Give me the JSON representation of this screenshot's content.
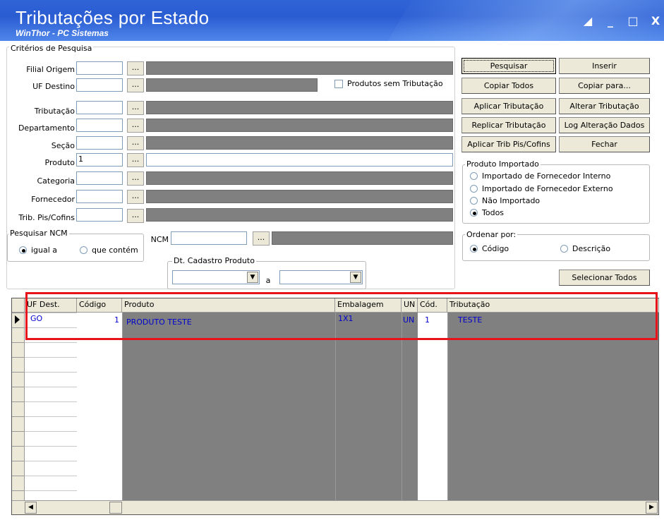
{
  "window": {
    "title": "Tributações por Estado",
    "subtitle": "WinThor - PC Sistemas",
    "controls": [
      "◢",
      "_",
      "□",
      "X"
    ]
  },
  "criteria": {
    "group_label": "Critérios de Pesquisa",
    "fields": {
      "filial_origem": "Filial Origem",
      "uf_destino": "UF Destino",
      "tributacao": "Tributação",
      "departamento": "Departamento",
      "secao": "Seção",
      "produto": "Produto",
      "produto_value": "1",
      "categoria": "Categoria",
      "fornecedor": "Fornecedor",
      "trib_pis_cofins": "Trib. Pis/Cofins"
    },
    "dots": "...",
    "produtos_sem_tributacao": "Produtos sem Tributação"
  },
  "ncm": {
    "group_label": "Pesquisar NCM",
    "igual_a": "igual a",
    "que_contem": "que contém",
    "ncm_label": "NCM"
  },
  "dt_cadastro": {
    "group_label": "Dt. Cadastro Produto",
    "a": "a"
  },
  "buttons": {
    "pesquisar": "Pesquisar",
    "inserir": "Inserir",
    "copiar_todos": "Copiar Todos",
    "copiar_para": "Copiar para...",
    "aplicar_tributacao": "Aplicar Tributação",
    "alterar_tributacao": "Alterar Tributação",
    "replicar_tributacao": "Replicar Tributação",
    "log_alteracao": "Log Alteração Dados",
    "aplicar_trib_pis": "Aplicar Trib Pis/Cofins",
    "fechar": "Fechar",
    "selecionar_todos": "Selecionar Todos"
  },
  "produto_importado": {
    "group_label": "Produto Importado",
    "options": [
      "Importado de Fornecedor Interno",
      "Importado de Fornecedor Externo",
      "Não Importado",
      "Todos"
    ],
    "selected": "Todos"
  },
  "ordenar": {
    "group_label": "Ordenar por:",
    "options": [
      "Código",
      "Descrição"
    ],
    "selected": "Código"
  },
  "grid": {
    "columns": [
      "UF Dest.",
      "Código",
      "Produto",
      "Embalagem",
      "UN",
      "Cód.",
      "Tributação"
    ],
    "rows": [
      {
        "uf": "GO",
        "codigo": "1",
        "produto": "PRODUTO TESTE",
        "embalagem": "1X1",
        "un": "UN",
        "cod": "1",
        "tributacao": "TESTE"
      }
    ]
  },
  "colors": {
    "highlight": "#e8121a",
    "titlebar": "#2a5cd2",
    "grid_text": "#0000cc"
  }
}
